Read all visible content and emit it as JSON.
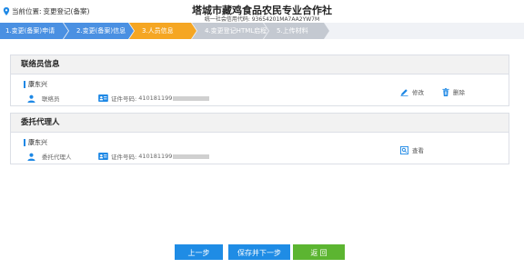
{
  "header": {
    "location_prefix": "当前位置:",
    "location_value": "变更登记(备案)",
    "org_name": "塔城市藏鸡食品农民专业合作社",
    "credit_code": "统一社会信用代码: 93654201MA7AA2YW7M"
  },
  "steps": [
    {
      "label": "1.变更(备案)申请",
      "state": "done"
    },
    {
      "label": "2.变更(备案)信息",
      "state": "done"
    },
    {
      "label": "3.人员信息",
      "state": "active"
    },
    {
      "label": "4.变更登记HTML启程",
      "state": "todo"
    },
    {
      "label": "5.上传材料",
      "state": "todo"
    }
  ],
  "contact_section": {
    "title": "联络员信息",
    "person": {
      "name": "康东兴",
      "role": "联络员",
      "id_label": "证件号码:",
      "id_value": "410181199"
    },
    "edit_label": "修改",
    "delete_label": "删除"
  },
  "agent_section": {
    "title": "委托代理人",
    "person": {
      "name": "康东兴",
      "role": "委托代理人",
      "id_label": "证件号码:",
      "id_value": "410181199"
    },
    "view_label": "查看"
  },
  "buttons": {
    "prev": "上一步",
    "save_next": "保存并下一步",
    "back": "返 回"
  },
  "colors": {
    "step_done": "#4a90e2",
    "step_active": "#f5a623",
    "step_todo": "#c4c9d1",
    "primary_button": "#1f8ce5",
    "back_button": "#5cb531"
  }
}
